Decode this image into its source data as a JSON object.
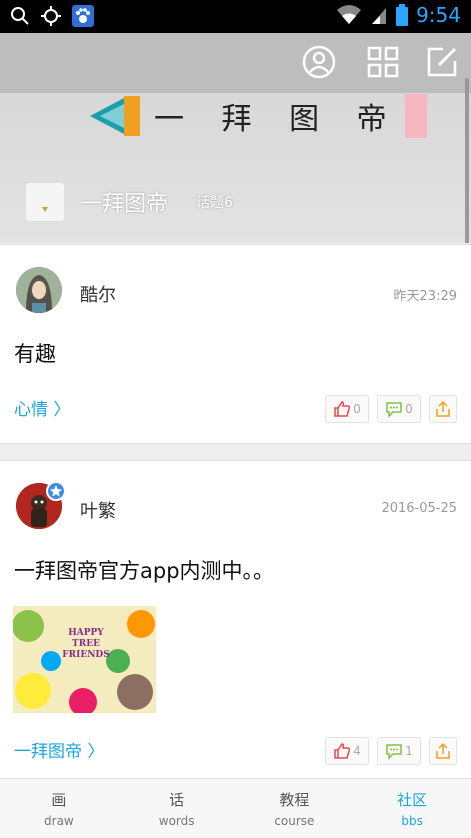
{
  "status_bar": {
    "clock": "9:54",
    "icons": [
      "search-icon",
      "location-icon",
      "paw-icon",
      "wifi-icon",
      "signal-icon",
      "battery-icon"
    ]
  },
  "header": {
    "banner_title": "一 拜 图 帝",
    "community_name": "一拜图帝",
    "topic_count": "话题6",
    "toolbar_icons": [
      "user-icon",
      "grid-icon",
      "compose-icon"
    ]
  },
  "posts": [
    {
      "author": "酷尔",
      "time": "昨天23:29",
      "content": "有趣",
      "tag": "心情 〉",
      "likes": "0",
      "comments": "0"
    },
    {
      "author": "叶繁",
      "time": "2016-05-25",
      "content": "一拜图帝官方app内测中。。",
      "image_text": "HAPPY TREE FRIENDS",
      "tag": "一拜图帝 〉",
      "likes": "4",
      "comments": "1"
    }
  ],
  "bottom_nav": [
    {
      "cn": "画",
      "en": "draw"
    },
    {
      "cn": "话",
      "en": "words"
    },
    {
      "cn": "教程",
      "en": "course"
    },
    {
      "cn": "社区",
      "en": "bbs",
      "active": true
    }
  ],
  "colors": {
    "accent": "#1ba7e0",
    "like": "#e84a4a",
    "comment": "#7cc242",
    "share": "#f0a020"
  }
}
